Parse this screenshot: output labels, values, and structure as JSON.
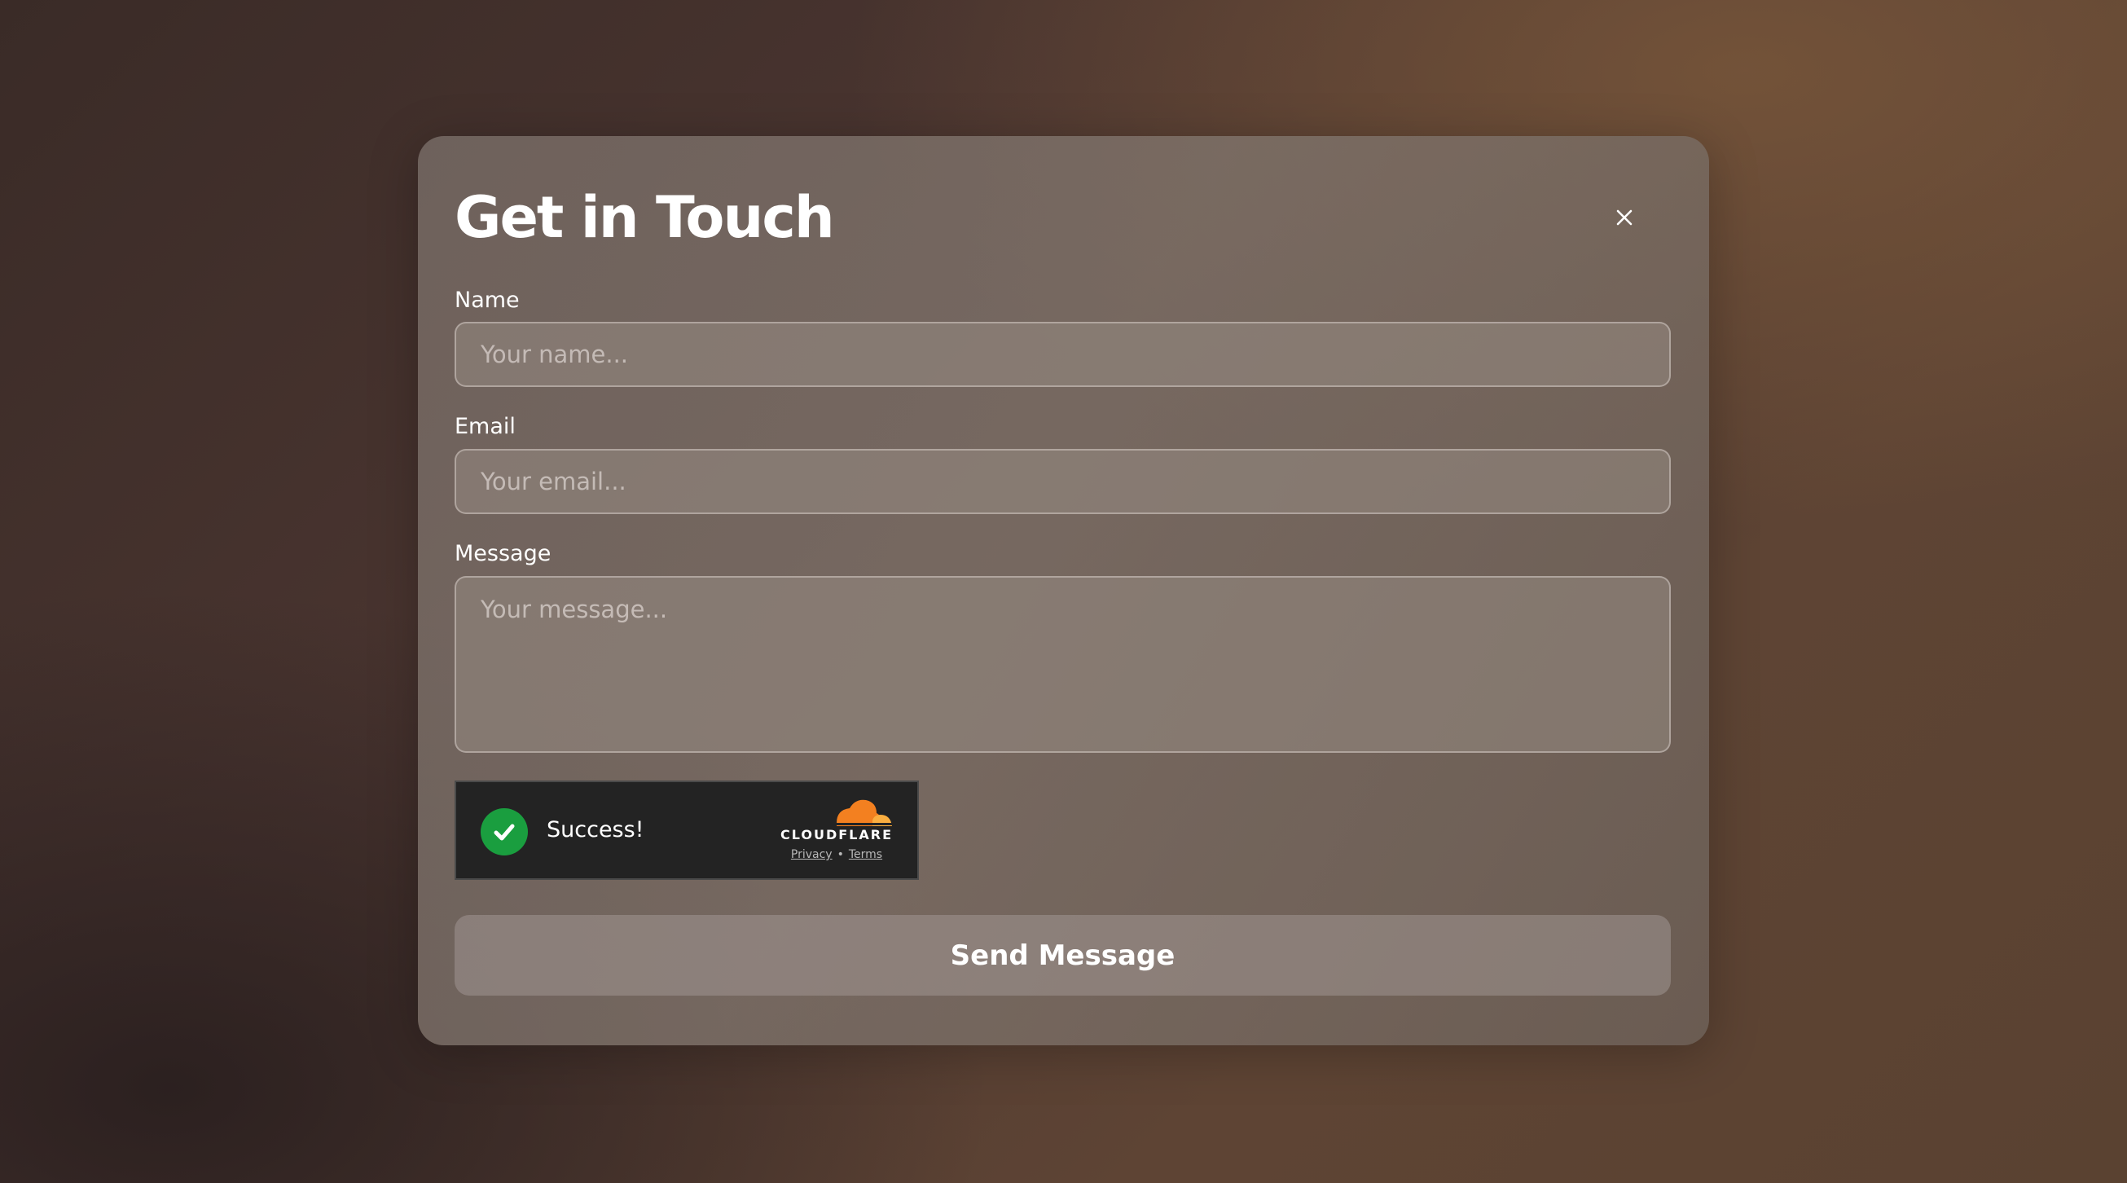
{
  "modal": {
    "title": "Get in Touch",
    "close_icon": "close-icon"
  },
  "form": {
    "name": {
      "label": "Name",
      "placeholder": "Your name...",
      "value": ""
    },
    "email": {
      "label": "Email",
      "placeholder": "Your email...",
      "value": ""
    },
    "message": {
      "label": "Message",
      "placeholder": "Your message...",
      "value": ""
    },
    "submit_label": "Send Message"
  },
  "captcha": {
    "status_text": "Success!",
    "status_icon": "checkmark-circle-icon",
    "provider": "CLOUDFLARE",
    "privacy_link": "Privacy",
    "separator": "•",
    "terms_link": "Terms"
  },
  "colors": {
    "success_green": "#1a9e3f",
    "cloudflare_orange": "#f38020",
    "cloudflare_light_orange": "#faae40",
    "widget_background": "#232323"
  }
}
